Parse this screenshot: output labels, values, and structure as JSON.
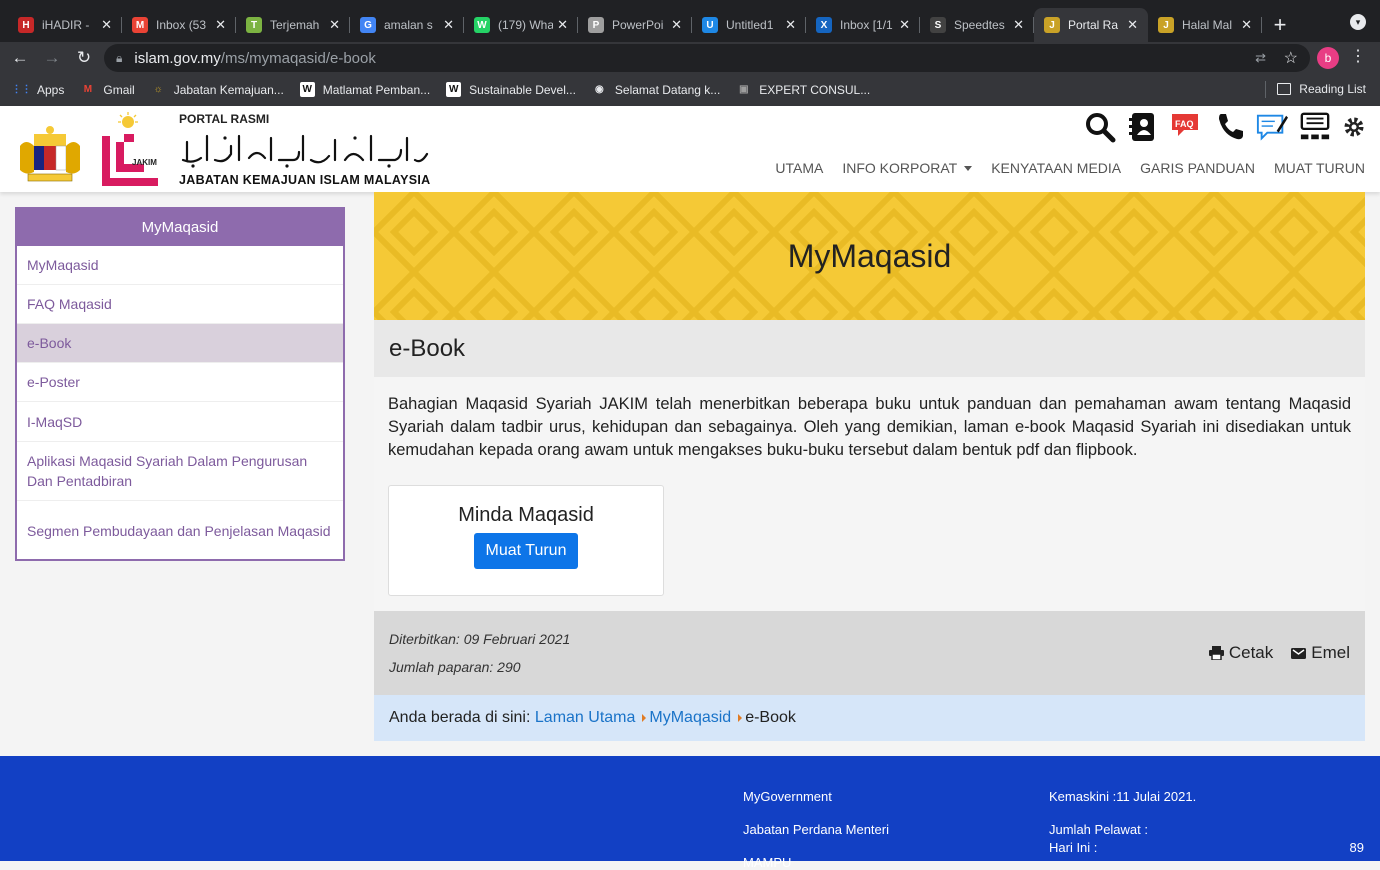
{
  "browser": {
    "tabs": [
      {
        "title": "iHADIR -",
        "fav": "H",
        "favcolor": "#c62828"
      },
      {
        "title": "Inbox (53",
        "fav": "M",
        "favcolor": "#ea4335"
      },
      {
        "title": "Terjemah",
        "fav": "T",
        "favcolor": "#7cb342"
      },
      {
        "title": "amalan s",
        "fav": "G",
        "favcolor": "#4285f4"
      },
      {
        "title": "(179) Wha",
        "fav": "W",
        "favcolor": "#25d366"
      },
      {
        "title": "PowerPoi",
        "fav": "P",
        "favcolor": "#9e9e9e"
      },
      {
        "title": "Untitled1",
        "fav": "U",
        "favcolor": "#1e88e5"
      },
      {
        "title": "Inbox [1/1",
        "fav": "X",
        "favcolor": "#1565c0"
      },
      {
        "title": "Speedtes",
        "fav": "S",
        "favcolor": "#424242"
      },
      {
        "title": "Portal Ra",
        "fav": "J",
        "favcolor": "#c9a227",
        "active": true
      },
      {
        "title": "Halal Mal",
        "fav": "J",
        "favcolor": "#c9a227"
      }
    ],
    "url_host": "islam.gov.my",
    "url_path": "/ms/mymaqasid/e-book",
    "profile_initial": "b",
    "bookmarks": [
      {
        "label": "Apps",
        "icon": "apps-grid-icon"
      },
      {
        "label": "Gmail",
        "icon": "gmail-icon"
      },
      {
        "label": "Jabatan Kemajuan...",
        "icon": "jakim-icon"
      },
      {
        "label": "Matlamat Pemban...",
        "icon": "wikipedia-icon"
      },
      {
        "label": "Sustainable Devel...",
        "icon": "wikipedia-icon"
      },
      {
        "label": "Selamat Datang k...",
        "icon": "globe-icon"
      },
      {
        "label": "EXPERT CONSUL...",
        "icon": "expert-icon"
      }
    ],
    "reading_list": "Reading List"
  },
  "header": {
    "portal_label": "PORTAL RASMI",
    "logo_text": "JAKIM",
    "jakim_name": "JABATAN KEMAJUAN ISLAM MALAYSIA",
    "faq_badge": "FAQ",
    "nav": [
      "UTAMA",
      "INFO KORPORAT",
      "KENYATAAN MEDIA",
      "GARIS PANDUAN",
      "MUAT TURUN"
    ]
  },
  "sidebar": {
    "title": "MyMaqasid",
    "items": [
      {
        "label": "MyMaqasid"
      },
      {
        "label": "FAQ Maqasid"
      },
      {
        "label": "e-Book",
        "active": true
      },
      {
        "label": "e-Poster"
      },
      {
        "label": "I-MaqSD"
      },
      {
        "label": "Aplikasi Maqasid Syariah Dalam Pengurusan Dan Pentadbiran"
      },
      {
        "label": "Segmen Pembudayaan dan Penjelasan Maqasid"
      }
    ]
  },
  "main": {
    "banner_title": "MyMaqasid",
    "page_title": "e-Book",
    "intro": "Bahagian Maqasid Syariah JAKIM telah menerbitkan beberapa buku untuk panduan dan pemahaman awam tentang Maqasid Syariah dalam tadbir urus, kehidupan dan sebagainya. Oleh yang demikian, laman e-book Maqasid Syariah ini disediakan untuk kemudahan kepada orang awam untuk mengakses buku-buku tersebut dalam bentuk pdf dan flipbook.",
    "book": {
      "title": "Minda Maqasid",
      "button": "Muat Turun"
    },
    "published": "Diterbitkan: 09 Februari 2021",
    "views": "Jumlah paparan: 290",
    "print_label": "Cetak",
    "email_label": "Emel",
    "breadcrumb": {
      "prefix": "Anda berada di sini:",
      "home": "Laman Utama",
      "section": "MyMaqasid",
      "current": "e-Book"
    }
  },
  "footer": {
    "links": [
      "MyGovernment",
      "Jabatan Perdana Menteri",
      "MAMPU"
    ],
    "updated": "Kemaskini :11 Julai 2021.",
    "visitors_label": "Jumlah Pelawat :",
    "today_label": "Hari Ini :",
    "today_value": "89"
  },
  "colors": {
    "accent_purple": "#8e6bad",
    "banner_yellow": "#f5c936",
    "link_blue": "#1a73c8",
    "button_blue": "#0d75e8",
    "footer_blue": "#1240c4"
  }
}
